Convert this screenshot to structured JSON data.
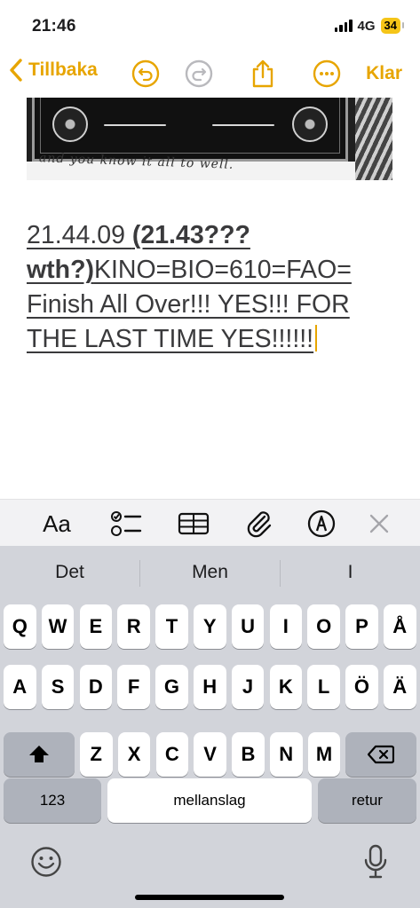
{
  "status_bar": {
    "time": "21:46",
    "network": "4G",
    "battery": "34"
  },
  "nav": {
    "back_label": "Tillbaka",
    "done_label": "Klar"
  },
  "image": {
    "caption": "and you know it all to well."
  },
  "note": {
    "part1": "21.44.09 ",
    "part2_bold": "(21.43??? wth?)",
    "part3": "KINO=BIO=610=FAO= Finish All Over!!! YES!!! FOR THE LAST TIME YES!!!!!!"
  },
  "format_toolbar": {
    "text_format_label": "Aa",
    "icons": [
      "checklist-icon",
      "table-icon",
      "attachment-icon",
      "markup-icon",
      "close-icon"
    ]
  },
  "keyboard": {
    "suggestions": [
      "Det",
      "Men",
      "I"
    ],
    "row1": [
      "Q",
      "W",
      "E",
      "R",
      "T",
      "Y",
      "U",
      "I",
      "O",
      "P",
      "Å"
    ],
    "row2": [
      "A",
      "S",
      "D",
      "F",
      "G",
      "H",
      "J",
      "K",
      "L",
      "Ö",
      "Ä"
    ],
    "row3": [
      "Z",
      "X",
      "C",
      "V",
      "B",
      "N",
      "M"
    ],
    "numbers_label": "123",
    "space_label": "mellanslag",
    "return_label": "retur"
  },
  "colors": {
    "accent": "#e7a500",
    "keyboard_bg": "#d2d4da",
    "key_bg": "#ffffff",
    "dark_key_bg": "#aeb2bb"
  }
}
